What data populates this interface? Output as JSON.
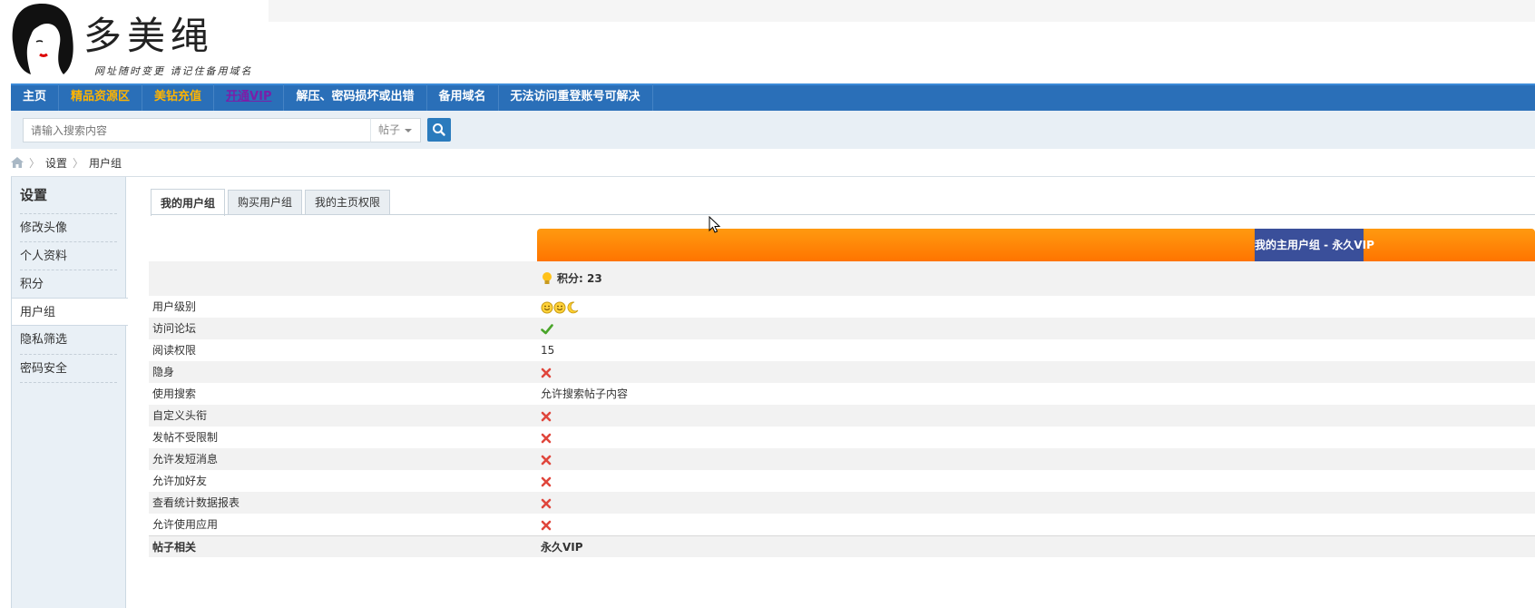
{
  "header": {
    "logo_text": "多美绳",
    "slogan": "网址随时变更 请记住备用域名"
  },
  "nav": {
    "items": [
      {
        "label": "主页",
        "style": "normal"
      },
      {
        "label": "精品资源区",
        "style": "orange"
      },
      {
        "label": "美钻充值",
        "style": "orange"
      },
      {
        "label": "开通VIP",
        "style": "vip"
      },
      {
        "label": "解压、密码损坏或出错",
        "style": "normal"
      },
      {
        "label": "备用域名",
        "style": "normal"
      },
      {
        "label": "无法访问重登账号可解决",
        "style": "normal"
      }
    ]
  },
  "search": {
    "placeholder": "请输入搜索内容",
    "type_label": "帖子",
    "icon": "search-icon"
  },
  "breadcrumb": {
    "items": [
      "设置",
      "用户组"
    ]
  },
  "sidebar": {
    "title": "设置",
    "items": [
      {
        "label": "修改头像"
      },
      {
        "label": "个人资料"
      },
      {
        "label": "积分"
      },
      {
        "label": "用户组"
      },
      {
        "label": "隐私筛选"
      },
      {
        "label": "密码安全"
      }
    ],
    "active_index": 3
  },
  "tabs": {
    "items": [
      "我的用户组",
      "购买用户组",
      "我的主页权限"
    ],
    "active_index": 0
  },
  "group": {
    "badge": "我的主用户组 - 永久VIP",
    "points_label": "积分: 23"
  },
  "rows": [
    {
      "label": "用户级别",
      "type": "stars"
    },
    {
      "label": "访问论坛",
      "type": "yes"
    },
    {
      "label": "阅读权限",
      "type": "text",
      "value": "15"
    },
    {
      "label": "隐身",
      "type": "no"
    },
    {
      "label": "使用搜索",
      "type": "text",
      "value": "允许搜索帖子内容"
    },
    {
      "label": "自定义头衔",
      "type": "no"
    },
    {
      "label": "发帖不受限制",
      "type": "no"
    },
    {
      "label": "允许发短消息",
      "type": "no"
    },
    {
      "label": "允许加好友",
      "type": "no"
    },
    {
      "label": "查看统计数据报表",
      "type": "no"
    },
    {
      "label": "允许使用应用",
      "type": "no"
    }
  ],
  "summary_row": {
    "label": "帖子相关",
    "value": "永久VIP"
  },
  "colors": {
    "nav_bg": "#2a6fb8",
    "accent_orange": "#ff8000",
    "badge_bg": "#3a4f9a",
    "no_red": "#e0463c",
    "yes_green": "#4aa52a"
  }
}
